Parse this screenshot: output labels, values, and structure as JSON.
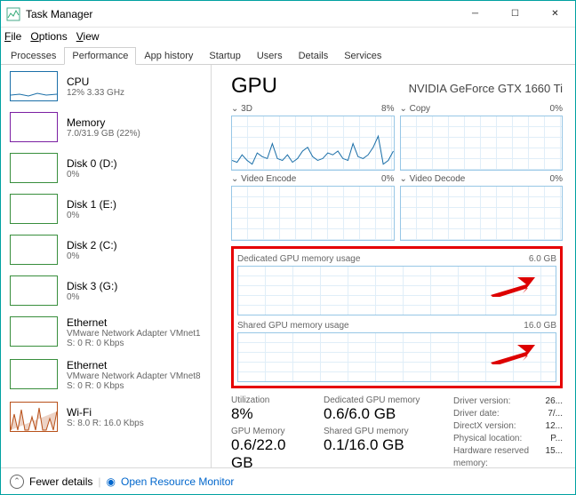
{
  "window": {
    "title": "Task Manager"
  },
  "menu": {
    "file": "File",
    "options": "Options",
    "view": "View"
  },
  "tabs": [
    "Processes",
    "Performance",
    "App history",
    "Startup",
    "Users",
    "Details",
    "Services"
  ],
  "active_tab": "Performance",
  "sidebar": {
    "items": [
      {
        "name": "CPU",
        "sub": "12% 3.33 GHz"
      },
      {
        "name": "Memory",
        "sub": "7.0/31.9 GB (22%)"
      },
      {
        "name": "Disk 0 (D:)",
        "sub": "0%"
      },
      {
        "name": "Disk 1 (E:)",
        "sub": "0%"
      },
      {
        "name": "Disk 2 (C:)",
        "sub": "0%"
      },
      {
        "name": "Disk 3 (G:)",
        "sub": "0%"
      },
      {
        "name": "Ethernet",
        "sub": "VMware Network Adapter VMnet1",
        "sub2": "S: 0 R: 0 Kbps"
      },
      {
        "name": "Ethernet",
        "sub": "VMware Network Adapter VMnet8",
        "sub2": "S: 0 R: 0 Kbps"
      },
      {
        "name": "Wi-Fi",
        "sub": "S: 8.0 R: 16.0 Kbps"
      }
    ]
  },
  "main": {
    "title": "GPU",
    "device": "NVIDIA GeForce GTX 1660 Ti",
    "top_charts": [
      {
        "label": "3D",
        "pct": "8%",
        "chev": "⌄"
      },
      {
        "label": "Copy",
        "pct": "0%",
        "chev": "⌄"
      },
      {
        "label": "Video Encode",
        "pct": "0%",
        "chev": "⌄"
      },
      {
        "label": "Video Decode",
        "pct": "0%",
        "chev": "⌄"
      }
    ],
    "mem_charts": [
      {
        "label": "Dedicated GPU memory usage",
        "max": "6.0 GB"
      },
      {
        "label": "Shared GPU memory usage",
        "max": "16.0 GB"
      }
    ],
    "stats": {
      "util_label": "Utilization",
      "util": "8%",
      "gpumem_label": "GPU Memory",
      "gpumem": "0.6/22.0 GB",
      "dedmem_label": "Dedicated GPU memory",
      "dedmem": "0.6/6.0 GB",
      "shmem_label": "Shared GPU memory",
      "shmem": "0.1/16.0 GB",
      "rows": [
        {
          "k": "Driver version:",
          "v": "26..."
        },
        {
          "k": "Driver date:",
          "v": "7/..."
        },
        {
          "k": "DirectX version:",
          "v": "12..."
        },
        {
          "k": "Physical location:",
          "v": "P..."
        },
        {
          "k": "Hardware reserved memory:",
          "v": "15..."
        }
      ]
    }
  },
  "footer": {
    "fewer": "Fewer details",
    "monitor": "Open Resource Monitor"
  },
  "chart_data": {
    "type": "line",
    "title": "3D",
    "ylabel": "%",
    "ylim": [
      0,
      100
    ],
    "values": [
      5,
      4,
      8,
      5,
      3,
      9,
      7,
      6,
      14,
      6,
      5,
      8,
      4,
      6,
      10,
      12,
      7,
      5,
      6,
      9,
      8,
      10,
      6,
      5,
      14,
      7,
      6,
      8,
      12,
      18,
      3,
      5,
      10
    ]
  }
}
